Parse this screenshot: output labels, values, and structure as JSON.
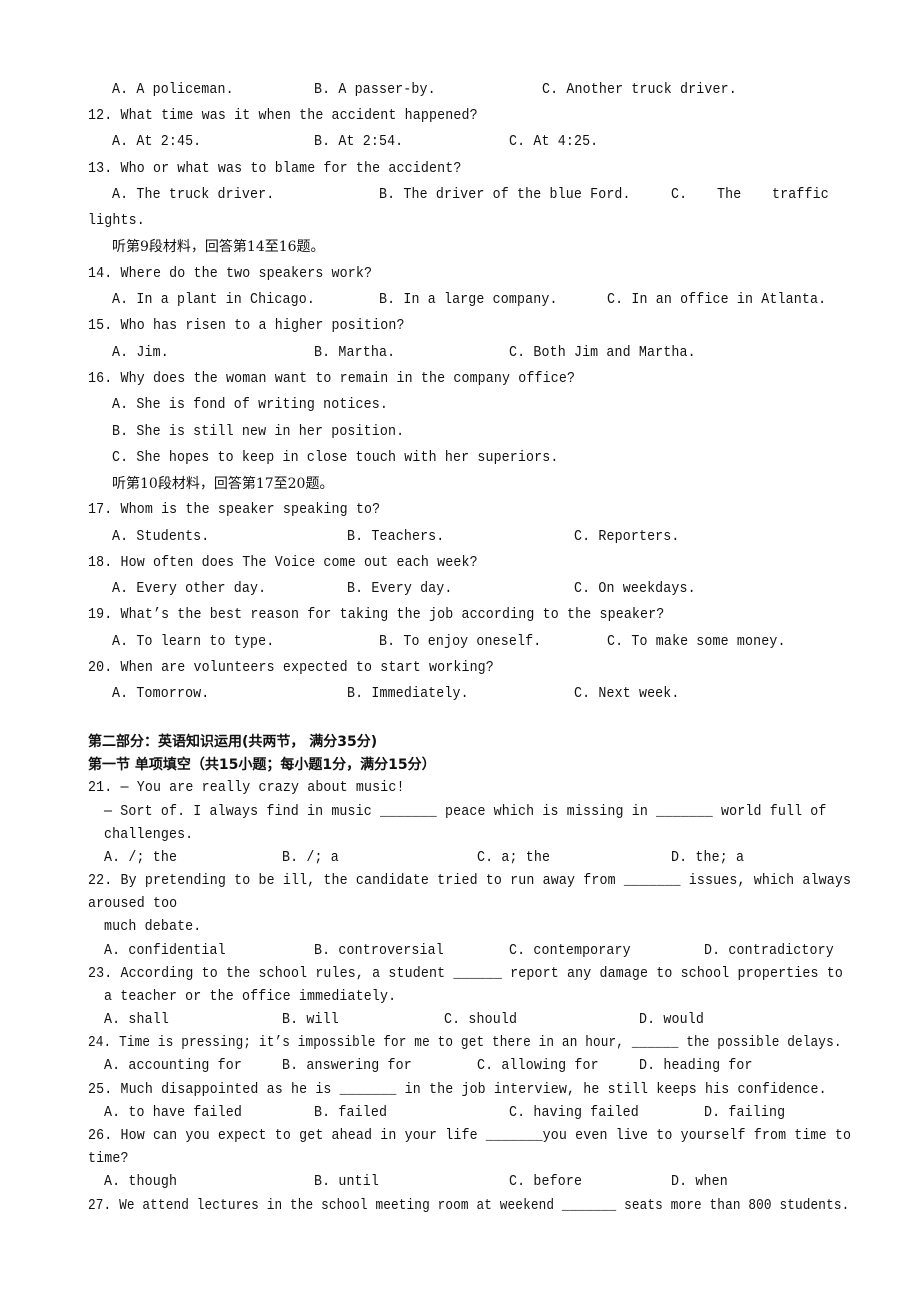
{
  "document": {
    "q11_options": [
      "A. A policeman.",
      "B. A passer-by.",
      "C. Another truck driver."
    ],
    "q12": {
      "stem": "12. What time was it when the accident happened?",
      "options": [
        "A. At 2:45.",
        "B. At 2:54.",
        "C. At 4:25."
      ]
    },
    "q13": {
      "stem": "13. Who or what was to blame for the accident?",
      "options": [
        "A. The truck driver.",
        "B. The driver of the blue Ford.",
        "C.",
        "The",
        "traffic"
      ],
      "continuation": "lights."
    },
    "section9": "听第9段材料，回答第14至16题。",
    "q14": {
      "stem": "14. Where do the two speakers work?",
      "options": [
        "A. In a plant in Chicago.",
        "B. In a large company.",
        "C. In an office in Atlanta."
      ]
    },
    "q15": {
      "stem": "15. Who has risen to a higher position?",
      "options": [
        "A. Jim.",
        "B. Martha.",
        "C. Both Jim and Martha."
      ]
    },
    "q16": {
      "stem": "16. Why does the woman want to remain in the company office?",
      "options": [
        "A. She is fond of writing notices.",
        "B. She is still new in her position.",
        "C. She hopes to keep in close touch with her superiors."
      ]
    },
    "section10": "听第10段材料，回答第17至20题。",
    "q17": {
      "stem": "17. Whom is the speaker speaking to?",
      "options": [
        "A. Students.",
        "B. Teachers.",
        "C. Reporters."
      ]
    },
    "q18": {
      "stem": "18. How often does The Voice come out each week?",
      "options": [
        "A. Every other day.",
        "B. Every day.",
        "C. On weekdays."
      ]
    },
    "q19": {
      "stem": "19. What’s the best reason for taking the job according to the speaker?",
      "options": [
        "A. To learn to type.",
        "B. To enjoy oneself.",
        "C. To make some money."
      ]
    },
    "q20": {
      "stem": "20. When are volunteers expected to start working?",
      "options": [
        "A. Tomorrow.",
        "B. Immediately.",
        "C. Next week."
      ]
    },
    "part2_heading": "第二部分：英语知识运用(共两节， 满分35分)",
    "section1_heading": "第一节 单项填空（共15小题；每小题1分，满分15分）",
    "q21": {
      "stem": "21. — You are really crazy about music!",
      "line2": "— Sort of. I always find in music _______ peace which is missing in _______ world full of",
      "line3": "challenges.",
      "options": [
        "A. /; the",
        "B. /; a",
        "C. a; the",
        "D. the; a"
      ]
    },
    "q22": {
      "stem": "22. By pretending to be ill, the candidate tried to run away from _______ issues, which always",
      "line2": "aroused too",
      "line3": "much debate.",
      "options": [
        "A. confidential",
        "B. controversial",
        "C. contemporary",
        "D. contradictory"
      ]
    },
    "q23": {
      "stem": "23. According to the school rules, a student ______ report any damage to school properties to",
      "line2": "a teacher or the office immediately.",
      "options": [
        "A. shall",
        "B. will",
        "C. should",
        "D. would"
      ]
    },
    "q24": {
      "stem": "24. Time is pressing; it’s impossible for me to get there in an hour, ______ the possible delays.",
      "options": [
        "A. accounting for",
        "B. answering for",
        "C. allowing for",
        "D. heading for"
      ]
    },
    "q25": {
      "stem": "25. Much disappointed as he is _______ in the job interview, he still keeps his confidence.",
      "options": [
        "A. to have failed",
        "B. failed",
        "C. having failed",
        "D. failing"
      ]
    },
    "q26": {
      "stem": "26. How can you expect to get ahead in your life _______you even live to yourself from time to",
      "line2": "time?",
      "options": [
        "A. though",
        "B. until",
        "C. before",
        "D. when"
      ]
    },
    "q27": {
      "stem": "27. We attend lectures in the school meeting room at weekend _______ seats more than 800 students."
    }
  }
}
